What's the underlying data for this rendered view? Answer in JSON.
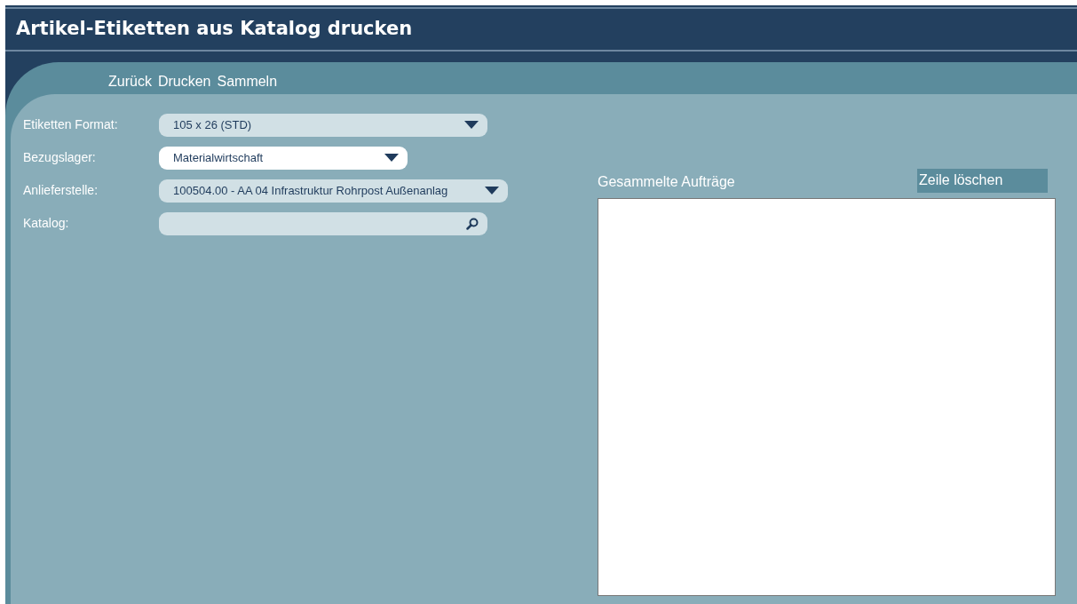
{
  "window": {
    "title": "Artikel-Etiketten aus Katalog drucken"
  },
  "toolbar": [
    "Zurück",
    "Drucken",
    "Sammeln"
  ],
  "form": [
    {
      "kind": "select",
      "label": "Etiketten Format:",
      "value": "105 x 26 (STD)",
      "focused": false
    },
    {
      "kind": "select",
      "label": "Bezugslager:",
      "value": "Materialwirtschaft",
      "focused": true
    },
    {
      "kind": "select",
      "label": "Anlieferstelle:",
      "value": "100504.00 - AA 04 Infrastruktur Rohrpost Außenanlag",
      "focused": false
    },
    {
      "kind": "search",
      "label": "Katalog:",
      "focused": false
    }
  ],
  "orders": {
    "title": "Gesammelte Aufträge",
    "delete_button": "Zeile löschen"
  }
}
